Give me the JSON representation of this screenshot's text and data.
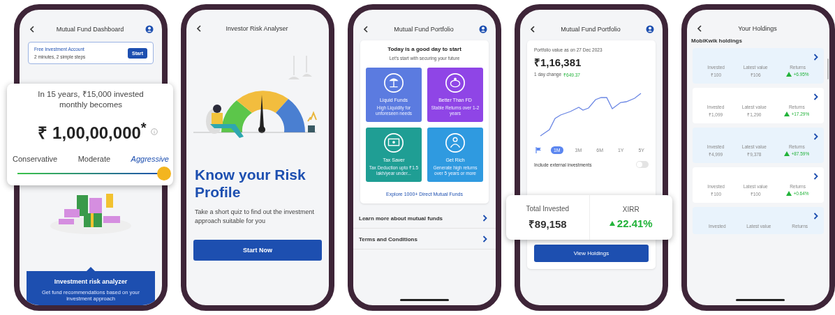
{
  "dashboard_screen": {
    "title": "Mutual Fund Dashboard",
    "banner": {
      "title": "Free Investment Account",
      "subtitle": "2 minutes, 2 simple steps",
      "button": "Start"
    },
    "projection": {
      "text": "In 15 years, ₹15,000 invested monthly becomes",
      "amount": "₹ 1,00,00,000$^{*}$",
      "level": 1,
      "profiles": [
        {
          "label": "Conservative",
          "selected": false
        },
        {
          "label": "Moderate",
          "selected": false
        },
        {
          "label": "Aggressive",
          "selected": true
        }
      ]
    },
    "analyzer": {
      "title": "Investment risk analyzer",
      "text": "Get fund recommendations based on your investment approach"
    }
  },
  "risk_screen": {
    "title": "Investor Risk Analyser",
    "heading": "Know your Risk Profile",
    "text": "Take a short quiz to find out the investment approach suitable for you",
    "button": "Start Now"
  },
  "portfolio_screen": {
    "title": "Mutual Fund Portfolio",
    "card_title": "Today is a good day to start",
    "card_subtitle": "Let's start with securing your future",
    "categories": [
      {
        "name": "Liquid Funds",
        "text": "High Liquidity for unforeseen needs",
        "color": "#5b7be0"
      },
      {
        "name": "Better Than FD",
        "text": "Stable Returns over 1-2 years",
        "color": "#8f45e6"
      },
      {
        "name": "Tax Saver",
        "text": "Tax Deduction upto ₹1.5 lakh/year under...",
        "color": "#1f9e94"
      },
      {
        "name": "Get Rich",
        "text": "Generate high returns over 5 years or more",
        "color": "#2f9ae0"
      }
    ],
    "explore_link": "Explore 1000+ Direct Mutual Funds",
    "links": [
      "Learn more about mutual funds",
      "Terms and Conditions"
    ]
  },
  "value_screen": {
    "title": "Mutual Fund Portfolio",
    "date_label": "Portfolio value as on 27 Dec 2023",
    "value": "₹1,16,381",
    "change_label": "1 day change",
    "change": "₹649.37",
    "periods": [
      {
        "label": "1M",
        "selected": true
      },
      {
        "label": "3M",
        "selected": false
      },
      {
        "label": "6M",
        "selected": false
      },
      {
        "label": "1Y",
        "selected": false
      },
      {
        "label": "5Y",
        "selected": false
      }
    ],
    "toggle": {
      "label": "Include external investments",
      "on": false
    },
    "summary": {
      "invested_label": "Total Invested",
      "invested": "₹89,158",
      "xirr_label": "XIRR",
      "xirr": "22.41%"
    },
    "button": "View Holdings"
  },
  "holdings_screen": {
    "title": "Your Holdings",
    "section": "MobiKwik holdings",
    "holdings": [
      {
        "invested_label": "Invested",
        "invested": "₹100",
        "latest_label": "Latest value",
        "latest": "₹106",
        "returns_label": "Returns",
        "returns": "+6.95%"
      },
      {
        "invested_label": "Invested",
        "invested": "₹1,099",
        "latest_label": "Latest value",
        "latest": "₹1,290",
        "returns_label": "Returns",
        "returns": "+17.29%"
      },
      {
        "invested_label": "Invested",
        "invested": "₹4,999",
        "latest_label": "Latest value",
        "latest": "₹9,378",
        "returns_label": "Returns",
        "returns": "+87.59%"
      },
      {
        "invested_label": "Invested",
        "invested": "₹100",
        "latest_label": "Latest value",
        "latest": "₹100",
        "returns_label": "Returns",
        "returns": "+0.64%"
      },
      {
        "invested_label": "Invested",
        "latest_label": "Latest value",
        "returns_label": "Returns"
      }
    ]
  }
}
